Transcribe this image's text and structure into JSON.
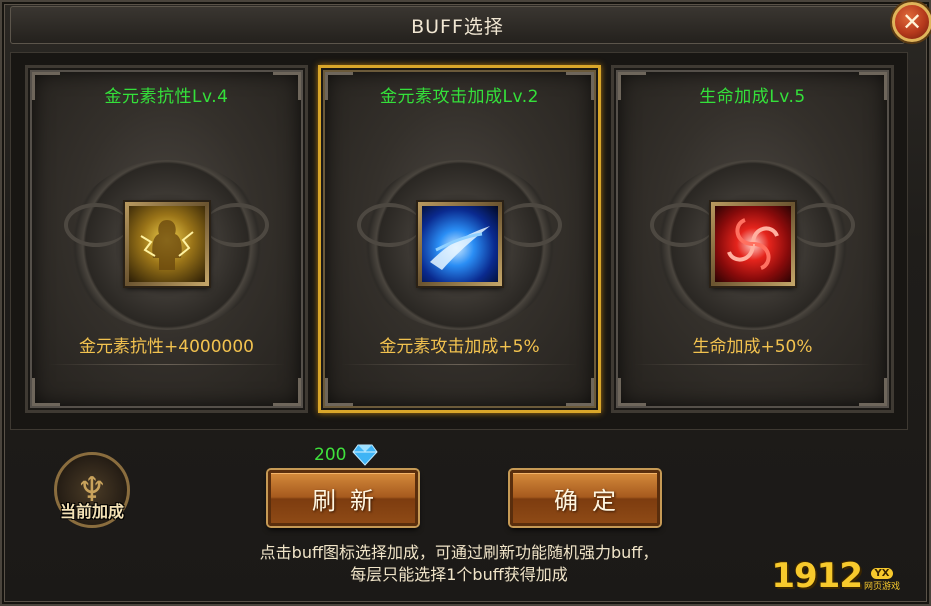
{
  "window": {
    "title": "BUFF选择",
    "close_icon": "close-icon"
  },
  "cards": [
    {
      "title": "金元素抗性Lv.4",
      "desc": "金元素抗性+4000000",
      "icon": "gold-element-icon",
      "selected": false,
      "color": "#d6a520"
    },
    {
      "title": "金元素攻击加成Lv.2",
      "desc": "金元素攻击加成+5%",
      "icon": "blue-slash-icon",
      "selected": true,
      "color": "#2a8ef5"
    },
    {
      "title": "生命加成Lv.5",
      "desc": "生命加成+50%",
      "icon": "red-vortex-icon",
      "selected": false,
      "color": "#e5241c"
    }
  ],
  "current_bonus": {
    "label": "当前加成",
    "icon": "current-bonus-emblem-icon"
  },
  "cost": {
    "value": "200",
    "icon": "diamond-icon"
  },
  "buttons": {
    "refresh": "刷新",
    "confirm": "确定"
  },
  "hint": {
    "line1": "点击buff图标选择加成，可通过刷新功能随机强力buff，",
    "line2": "每层只能选择1个buff获得加成"
  },
  "watermark": {
    "number": "1912",
    "badge": "YX",
    "sub": "网页游戏"
  },
  "colors": {
    "title_green": "#34e03a",
    "desc_gold": "#f2c24f",
    "selected_border": "#d9a62a"
  }
}
